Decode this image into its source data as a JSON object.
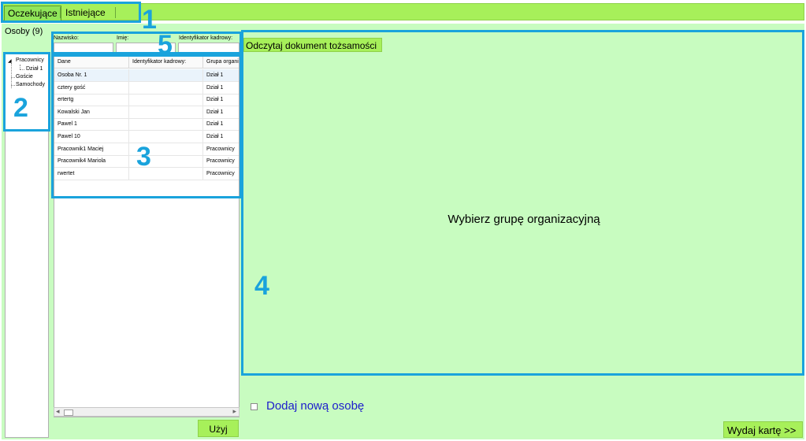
{
  "tabs": [
    {
      "label": "Oczekujące",
      "active": true
    },
    {
      "label": "Istniejące",
      "active": false
    }
  ],
  "persons_header": "Osoby (9)",
  "tree": {
    "items": [
      {
        "label": "Pracownicy",
        "level": 0,
        "expanded": true
      },
      {
        "label": "Dział 1",
        "level": 1
      },
      {
        "label": "Goście",
        "level": 0
      },
      {
        "label": "Samochody",
        "level": 0
      }
    ],
    "expand_glyph": "◢"
  },
  "filters": {
    "surname_label": "Nazwisko:",
    "name_label": "Imię:",
    "id_label": "Identyfikator kadrowy:"
  },
  "table": {
    "columns": [
      "Dane",
      "Identyfikator kadrowy:",
      "Grupa organizacyjna"
    ],
    "rows": [
      [
        "Osoba Nr. 1",
        "",
        "Dział 1"
      ],
      [
        "cztery gość",
        "",
        "Dział 1"
      ],
      [
        "ertertg",
        "",
        "Dział 1"
      ],
      [
        "Kowalski Jan",
        "",
        "Dział 1"
      ],
      [
        "Pawel 1",
        "",
        "Dział 1"
      ],
      [
        "Pawel 10",
        "",
        "Dział 1"
      ],
      [
        "Pracownik1 Maciej",
        "",
        "Pracownicy"
      ],
      [
        "Pracownik4 Mariola",
        "",
        "Pracownicy"
      ],
      [
        "rwertet",
        "",
        "Pracownicy"
      ]
    ]
  },
  "scroll": {
    "left_arrow": "◂",
    "right_arrow": "▸"
  },
  "buttons": {
    "use": "Użyj",
    "read_document": "Odczytaj dokument tożsamości",
    "issue_card": "Wydaj kartę  >>"
  },
  "right_panel": {
    "placeholder": "Wybierz grupę organizacyjną"
  },
  "add_person": {
    "label": "Dodaj nową osobę",
    "checked": false
  },
  "annotations": [
    "1",
    "2",
    "3",
    "4",
    "5"
  ],
  "colors": {
    "tab_green": "#a7f05a",
    "panel_green": "#c8fcc0",
    "annotation_blue": "#1aa3dc",
    "link_blue": "#1c1ccc"
  }
}
